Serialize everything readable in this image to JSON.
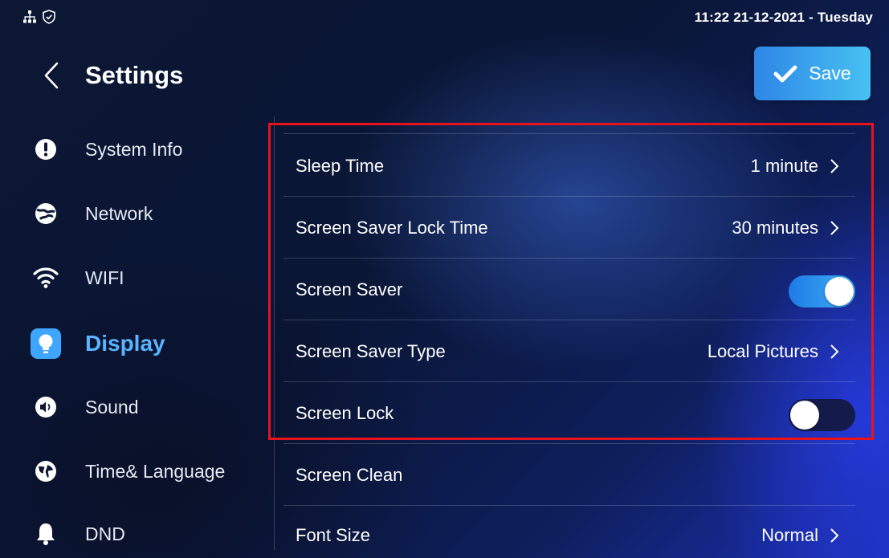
{
  "status_bar": {
    "icons": [
      "network-tree-icon",
      "shield-check-icon"
    ],
    "datetime": "11:22  21-12-2021 - Tuesday"
  },
  "header": {
    "title": "Settings",
    "back_icon": "chevron-left-icon",
    "save_label": "Save",
    "save_icon": "checkmark-icon"
  },
  "sidebar": {
    "items": [
      {
        "label": "System Info",
        "icon": "info-icon"
      },
      {
        "label": "Network",
        "icon": "globe-network-icon"
      },
      {
        "label": "WIFI",
        "icon": "wifi-icon"
      },
      {
        "label": "Display",
        "icon": "lightbulb-icon",
        "active": true
      },
      {
        "label": "Sound",
        "icon": "speaker-icon"
      },
      {
        "label": "Time& Language",
        "icon": "globe-icon"
      },
      {
        "label": "DND",
        "icon": "bell-icon"
      }
    ]
  },
  "settings": {
    "rows": [
      {
        "label": "Sleep Time",
        "value": "1 minute"
      },
      {
        "label": "Screen Saver Lock Time",
        "value": "30 minutes"
      },
      {
        "label": "Screen Saver",
        "toggle": true
      },
      {
        "label": "Screen Saver Type",
        "value": "Local Pictures"
      },
      {
        "label": "Screen Lock",
        "toggle": false
      },
      {
        "label": "Screen Clean"
      },
      {
        "label": "Font Size",
        "value": "Normal"
      }
    ]
  },
  "colors": {
    "accent": "#59b5ff",
    "highlight_box": "#e8121c",
    "toggle_on": "#2e8ff0",
    "toggle_off": "#141b4a"
  }
}
